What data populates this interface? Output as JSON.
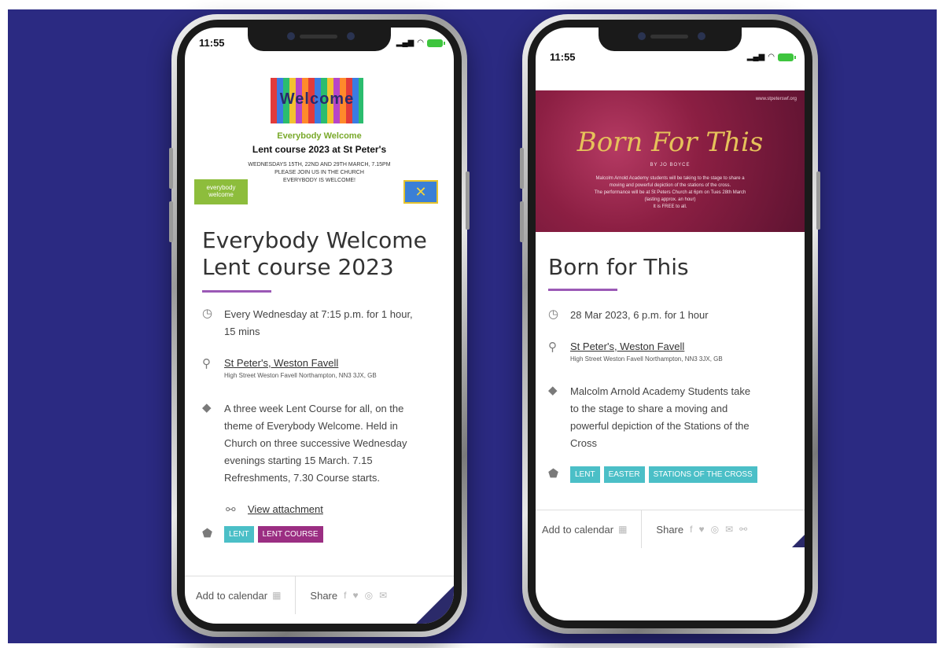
{
  "colors": {
    "background": "#2b2a82",
    "accent_purple": "#9b59b6",
    "tag_teal": "#4bbfc7",
    "tag_purple": "#9b2e82"
  },
  "left_phone": {
    "status_time": "11:55",
    "poster": {
      "welcome_text": "Welcome",
      "green_heading": "Everybody Welcome",
      "title": "Lent course 2023 at St Peter's",
      "details": "WEDNESDAYS 15TH, 22ND AND 29TH MARCH, 7.15PM\nPLEASE JOIN US IN THE CHURCH\nEVERYBODY IS WELCOME!",
      "logo_text": "everybody welcome"
    },
    "event_title_line1": "Everybody Welcome",
    "event_title_line2": "Lent course 2023",
    "schedule_line1": "Every Wednesday at 7:15 p.m. for 1 hour,",
    "schedule_line2": "15 mins",
    "location_name": "St Peter's, Weston Favell",
    "location_address": "High Street Weston Favell Northampton, NN3 3JX, GB",
    "description": [
      "A three week Lent Course for all, on the",
      "theme of Everybody Welcome. Held in",
      "Church on three successive Wednesday",
      "evenings starting 15 March. 7.15",
      "Refreshments, 7.30 Course starts."
    ],
    "attachment_label": "View attachment",
    "tags": [
      "LENT",
      "LENT COURSE"
    ],
    "add_to_calendar": "Add to calendar",
    "share_label": "Share"
  },
  "right_phone": {
    "status_time": "11:55",
    "poster": {
      "url": "www.stpeterswf.org",
      "title": "Born For This",
      "byline": "BY JO BOYCE",
      "details": "Malcolm Arnold Academy students will be taking to the stage to share a\nmoving and powerful depiction of the stations of the cross.\nThe performance will be at St Peters Church at 6pm on Tues 28th March\n(lasting approx. an hour)\nIt is FREE to all."
    },
    "event_title": "Born for This",
    "schedule": "28 Mar 2023, 6 p.m. for 1 hour",
    "location_name": "St Peter's, Weston Favell",
    "location_address": "High Street Weston Favell Northampton, NN3 3JX, GB",
    "description": [
      "Malcolm Arnold Academy Students take",
      "to the stage to share a moving and",
      "powerful depiction of the Stations of the",
      "Cross"
    ],
    "tags": [
      "LENT",
      "EASTER",
      "STATIONS OF THE CROSS"
    ],
    "add_to_calendar": "Add to calendar",
    "share_label": "Share"
  }
}
